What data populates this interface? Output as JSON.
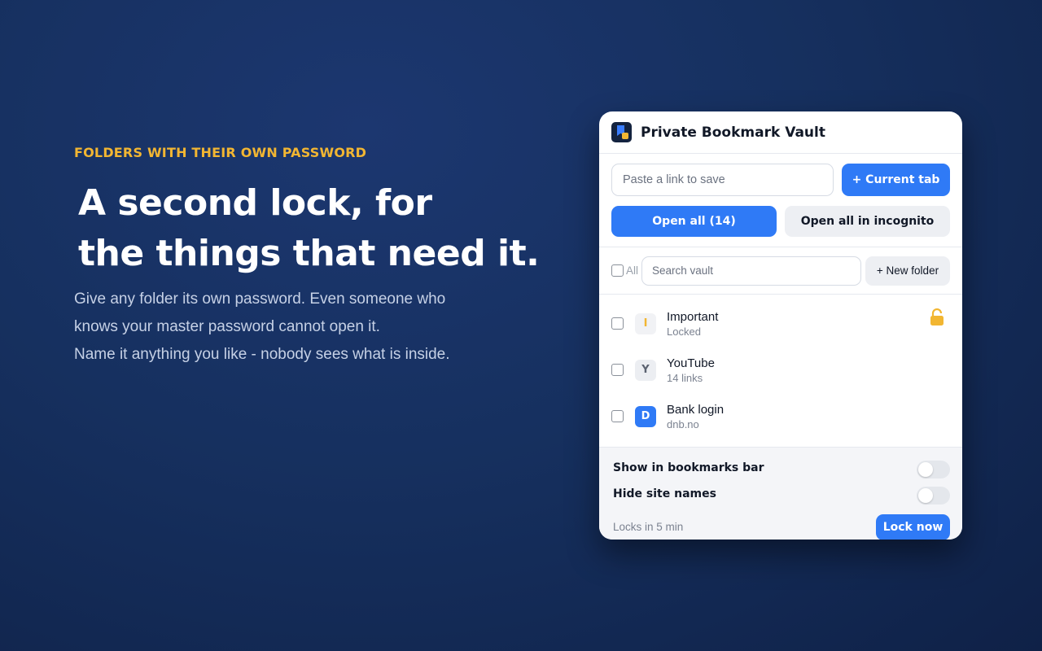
{
  "hero": {
    "eyebrow": "FOLDERS WITH THEIR OWN PASSWORD",
    "headline_line1": "A second lock, for",
    "headline_line2": "the things that need it.",
    "desc_line1": "Give any folder its own password. Even someone who",
    "desc_line2": "knows your master password cannot open it.",
    "desc_line3": "Name it anything you like - nobody sees what is inside."
  },
  "colors": {
    "accent": "#f2b632",
    "primary": "#2f7af6",
    "background": "#16305f"
  },
  "popup": {
    "title": "Private Bookmark Vault",
    "logo_icon": "vault-bookmark-lock-icon",
    "link_placeholder": "Paste a link to save",
    "current_tab_label": "+ Current tab",
    "open_all_label": "Open all (14)",
    "open_incognito_label": "Open all in incognito",
    "all_label": "All",
    "search_placeholder": "Search vault",
    "new_folder_label": "+ New folder",
    "items": [
      {
        "initial": "I",
        "name": "Important",
        "sub": "Locked",
        "locked": true,
        "avatar_bg": "#f1f2f5",
        "avatar_fg": "#f2b632"
      },
      {
        "initial": "Y",
        "name": "YouTube",
        "sub": "14 links",
        "locked": false,
        "avatar_bg": "#eceef2",
        "avatar_fg": "#5b6270"
      },
      {
        "initial": "D",
        "name": "Bank login",
        "sub": "dnb.no",
        "locked": false,
        "avatar_bg": "#2f7af6",
        "avatar_fg": "#ffffff"
      }
    ],
    "settings": {
      "show_bookmarks_bar": "Show in bookmarks bar",
      "hide_site_names": "Hide site names"
    },
    "locks_in": "Locks in 5 min",
    "lock_now_label": "Lock now"
  }
}
